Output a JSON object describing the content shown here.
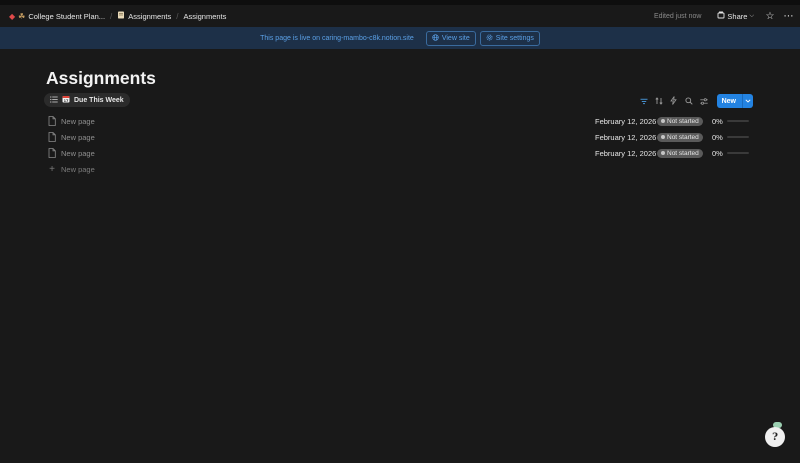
{
  "breadcrumbs": [
    {
      "label": "College Student Plan...",
      "icon": "home-icon"
    },
    {
      "label": "Assignments",
      "icon": "notebook-icon"
    },
    {
      "label": "Assignments",
      "icon": ""
    }
  ],
  "topbar": {
    "edited": "Edited just now",
    "share_label": "Share",
    "favorite_icon": "star-icon",
    "more_icon": "more-icon"
  },
  "banner": {
    "text": "This page is live on caring-mambo-c8k.notion.site",
    "view_site": "View site",
    "site_settings": "Site settings"
  },
  "page": {
    "title": "Assignments",
    "view_tab": "Due This Week",
    "view_tab_icon": "calendar-icon"
  },
  "toolbar": {
    "new_label": "New",
    "accent": "#2383e2"
  },
  "rows": [
    {
      "name": "New page",
      "date": "February 12, 2026",
      "status": "Not started",
      "progress_label": "0%",
      "progress": 0
    },
    {
      "name": "New page",
      "date": "February 12, 2026",
      "status": "Not started",
      "progress_label": "0%",
      "progress": 0
    },
    {
      "name": "New page",
      "date": "February 12, 2026",
      "status": "Not started",
      "progress_label": "0%",
      "progress": 0
    }
  ],
  "add_row_label": "New page",
  "colors": {
    "background": "#191919",
    "banner": "#1d3048",
    "banner_text": "#5ba0e6",
    "status_pill": "#5a5a5a"
  }
}
